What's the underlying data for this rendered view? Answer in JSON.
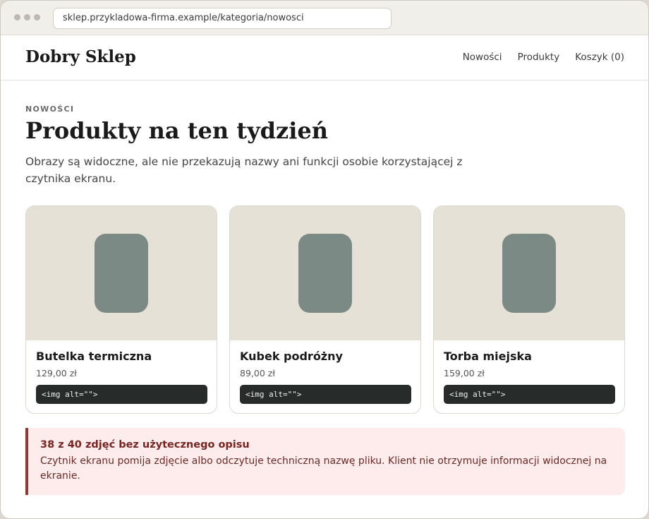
{
  "browser": {
    "url": "sklep.przykladowa-firma.example/kategoria/nowosci"
  },
  "header": {
    "brand": "Dobry Sklep",
    "nav": [
      {
        "label": "Nowości"
      },
      {
        "label": "Produkty"
      },
      {
        "label": "Koszyk (0)"
      }
    ]
  },
  "main": {
    "eyebrow": "NOWOŚCI",
    "title": "Produkty na ten tydzień",
    "lead": "Obrazy są widoczne, ale nie przekazują nazwy ani funkcji osobie korzystającej z czytnika ekranu.",
    "products": [
      {
        "name": "Butelka termiczna",
        "price": "129,00 zł",
        "code": "<img alt=\"\">"
      },
      {
        "name": "Kubek podróżny",
        "price": "89,00 zł",
        "code": "<img alt=\"\">"
      },
      {
        "name": "Torba miejska",
        "price": "159,00 zł",
        "code": "<img alt=\"\">"
      }
    ],
    "alert": {
      "title": "38 z 40 zdjęć bez użytecznego opisu",
      "body": "Czytnik ekranu pomija zdjęcie albo odczytuje techniczną nazwę pliku. Klient nie otrzymuje informacji widocznej na ekranie."
    }
  },
  "colors": {
    "image_bg": "#e6e1d7",
    "image_shape": "#7b8a84",
    "code_bg": "#272b29",
    "alert_bg": "#fdeceb",
    "alert_accent": "#8e3a33"
  }
}
